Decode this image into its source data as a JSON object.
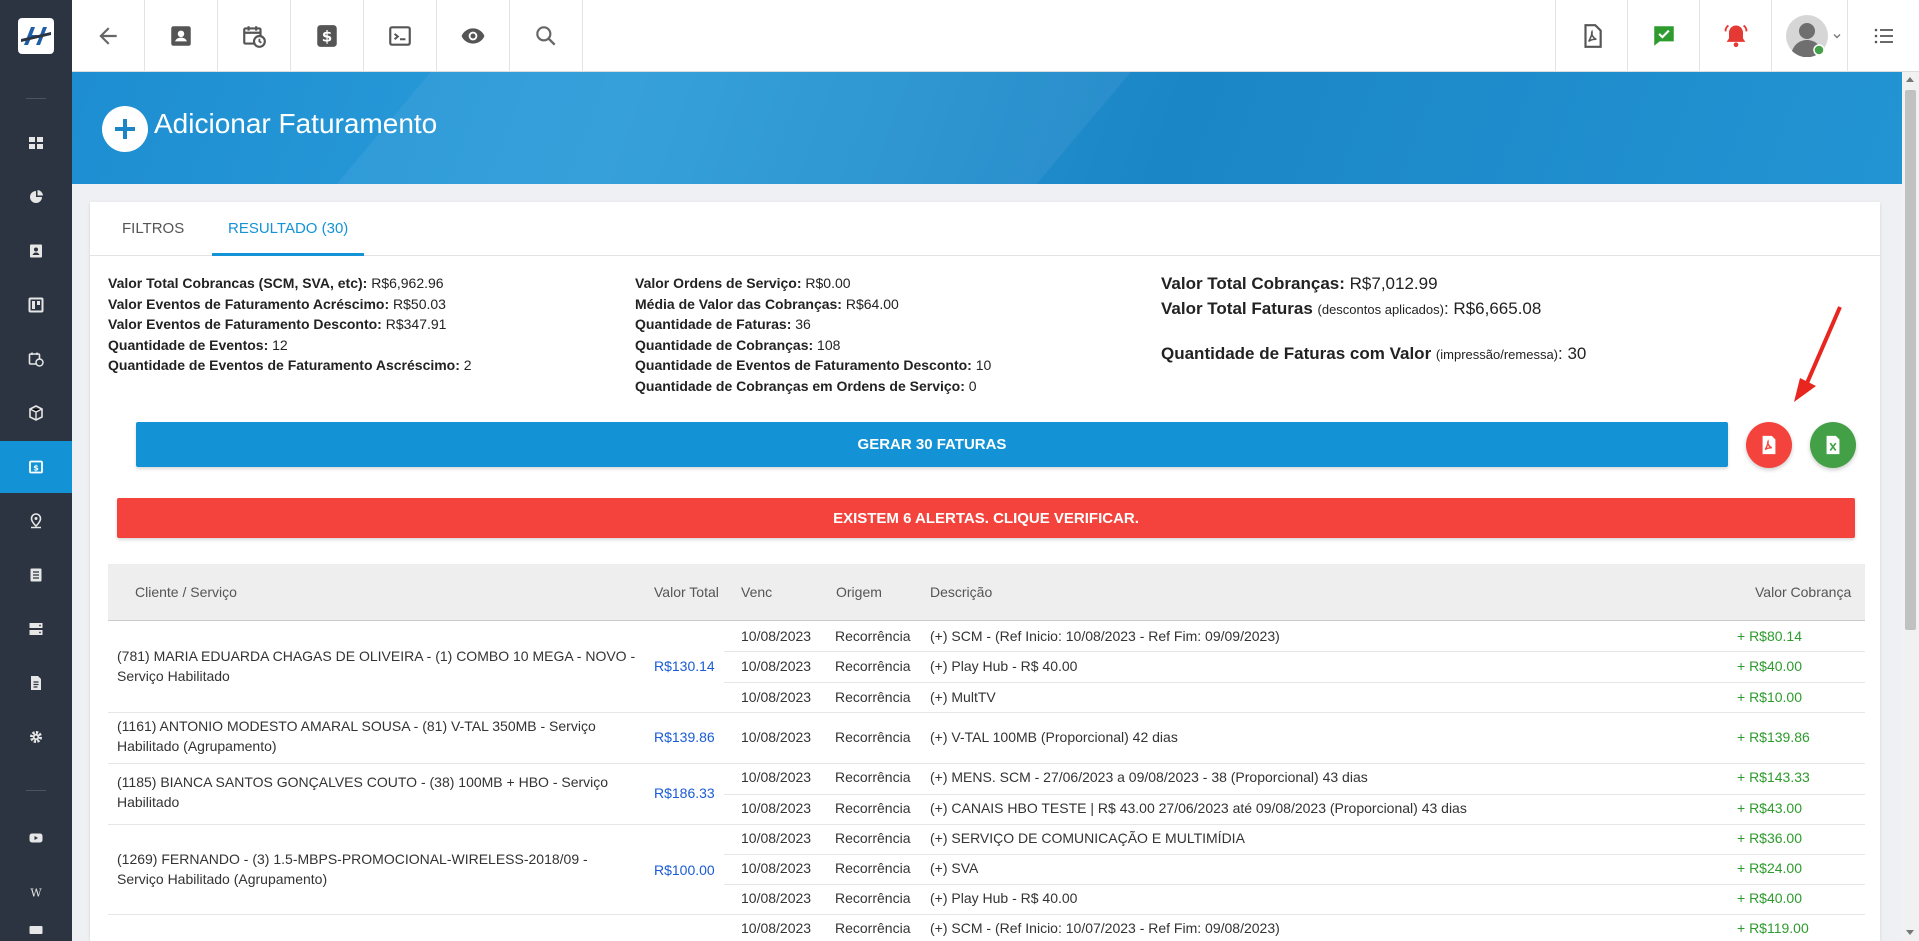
{
  "page": {
    "title": "Adicionar Faturamento"
  },
  "tabs": [
    {
      "label": "FILTROS"
    },
    {
      "label": "RESULTADO (30)"
    }
  ],
  "summary_left": [
    {
      "label": "Valor Total Cobrancas (SCM, SVA, etc):",
      "value": " R$6,962.96"
    },
    {
      "label": "Valor Eventos de Faturamento Acréscimo:",
      "value": " R$50.03"
    },
    {
      "label": "Valor Eventos de Faturamento Desconto:",
      "value": " R$347.91"
    },
    {
      "label": "Quantidade de Eventos:",
      "value": " 12"
    },
    {
      "label": "Quantidade de Eventos de Faturamento Ascréscimo:",
      "value": " 2"
    }
  ],
  "summary_mid": [
    {
      "label": "Valor Ordens de Serviço:",
      "value": " R$0.00"
    },
    {
      "label": "Média de Valor das Cobranças:",
      "value": " R$64.00"
    },
    {
      "label": "Quantidade de Faturas:",
      "value": " 36"
    },
    {
      "label": "Quantidade de Cobranças:",
      "value": " 108"
    },
    {
      "label": "Quantidade de Eventos de Faturamento Desconto:",
      "value": " 10"
    },
    {
      "label": "Quantidade de Cobranças em Ordens de Serviço:",
      "value": " 0"
    }
  ],
  "summary_right": {
    "total_cobrancas_label": "Valor Total Cobranças:",
    "total_cobrancas_value": " R$7,012.99",
    "total_faturas_label": "Valor Total Faturas",
    "total_faturas_note": "(descontos aplicados)",
    "total_faturas_value": ": R$6,665.08",
    "qtd_faturas_label": "Quantidade de Faturas com Valor",
    "qtd_faturas_note": "(impressão/remessa)",
    "qtd_faturas_value": ": 30"
  },
  "actions": {
    "gerar_label": "GERAR 30 FATURAS",
    "alert_label": "EXISTEM 6 ALERTAS. CLIQUE VERIFICAR."
  },
  "table": {
    "headers": {
      "cliente": "Cliente / Serviço",
      "valor_total": "Valor Total",
      "venc": "Venc",
      "origem": "Origem",
      "descricao": "Descrição",
      "valor_cobranca": "Valor Cobrança"
    },
    "clients": [
      {
        "name": "(781) MARIA EDUARDA CHAGAS DE OLIVEIRA - (1) COMBO 10 MEGA - NOVO - Serviço Habilitado",
        "total": "R$130.14"
      },
      {
        "name": "(1161) ANTONIO MODESTO AMARAL SOUSA - (81) V-TAL 350MB - Serviço Habilitado (Agrupamento)",
        "total": "R$139.86"
      },
      {
        "name": "(1185) BIANCA SANTOS GONÇALVES COUTO - (38) 100MB + HBO - Serviço Habilitado",
        "total": "R$186.33"
      },
      {
        "name": "(1269) FERNANDO - (3) 1.5-MBPS-PROMOCIONAL-WIRELESS-2018/09 - Serviço Habilitado (Agrupamento)",
        "total": "R$100.00"
      }
    ],
    "rows": [
      {
        "venc": "10/08/2023",
        "origem": "Recorrência",
        "descricao": "(+) SCM - (Ref Inicio: 10/08/2023 - Ref Fim: 09/09/2023)",
        "valor": "+ R$80.14"
      },
      {
        "venc": "10/08/2023",
        "origem": "Recorrência",
        "descricao": "(+) Play Hub - R$ 40.00",
        "valor": "+ R$40.00"
      },
      {
        "venc": "10/08/2023",
        "origem": "Recorrência",
        "descricao": "(+) MultTV",
        "valor": "+ R$10.00"
      },
      {
        "venc": "10/08/2023",
        "origem": "Recorrência",
        "descricao": "(+) V-TAL 100MB (Proporcional) 42 dias",
        "valor": "+ R$139.86"
      },
      {
        "venc": "10/08/2023",
        "origem": "Recorrência",
        "descricao": "(+) MENS. SCM - 27/06/2023 a 09/08/2023 - 38 (Proporcional) 43 dias",
        "valor": "+ R$143.33"
      },
      {
        "venc": "10/08/2023",
        "origem": "Recorrência",
        "descricao": "(+) CANAIS HBO TESTE | R$ 43.00 27/06/2023 até 09/08/2023 (Proporcional) 43 dias",
        "valor": "+ R$43.00"
      },
      {
        "venc": "10/08/2023",
        "origem": "Recorrência",
        "descricao": "(+) SERVIÇO DE COMUNICAÇÃO E MULTIMÍDIA",
        "valor": "+ R$36.00"
      },
      {
        "venc": "10/08/2023",
        "origem": "Recorrência",
        "descricao": "(+) SVA",
        "valor": "+ R$24.00"
      },
      {
        "venc": "10/08/2023",
        "origem": "Recorrência",
        "descricao": "(+) Play Hub - R$ 40.00",
        "valor": "+ R$40.00"
      },
      {
        "venc": "10/08/2023",
        "origem": "Recorrência",
        "descricao": "(+) SCM - (Ref Inicio: 10/07/2023 - Ref Fim: 09/08/2023)",
        "valor": "+ R$119.00"
      }
    ]
  },
  "colors": {
    "primary": "#1393d6",
    "danger": "#f4433c",
    "success": "#43a047",
    "sidebar": "#2b3440"
  }
}
